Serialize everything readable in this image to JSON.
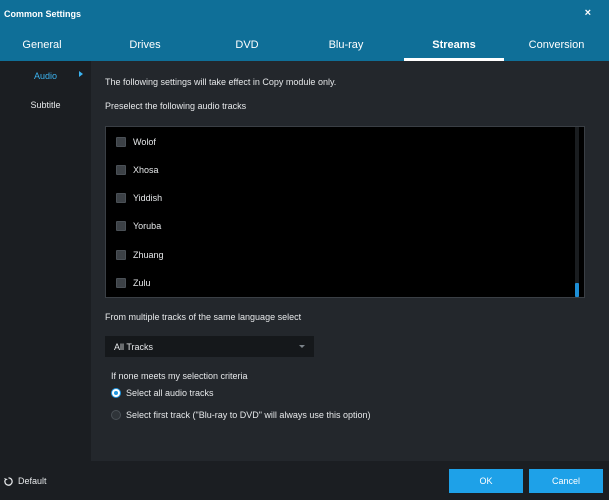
{
  "window": {
    "title": "Common Settings",
    "close_glyph": "×"
  },
  "tabs": [
    {
      "label": "General"
    },
    {
      "label": "Drives"
    },
    {
      "label": "DVD"
    },
    {
      "label": "Blu-ray"
    },
    {
      "label": "Streams",
      "active": true
    },
    {
      "label": "Conversion"
    }
  ],
  "sidebar": {
    "items": [
      {
        "label": "Audio",
        "active": true
      },
      {
        "label": "Subtitle"
      }
    ]
  },
  "main": {
    "note": "The following settings will take effect in Copy module only.",
    "preselect_label": "Preselect the following audio tracks",
    "tracks": [
      {
        "label": "Wolof",
        "checked": false
      },
      {
        "label": "Xhosa",
        "checked": false
      },
      {
        "label": "Yiddish",
        "checked": false
      },
      {
        "label": "Yoruba",
        "checked": false
      },
      {
        "label": "Zhuang",
        "checked": false
      },
      {
        "label": "Zulu",
        "checked": false
      }
    ],
    "multi_track_label": "From multiple tracks of the same language select",
    "multi_track_value": "All Tracks",
    "none_meets_label": "If none meets my selection criteria",
    "options": [
      {
        "label": "Select all audio tracks",
        "selected": true
      },
      {
        "label": "Select first track (\"Blu-ray to DVD\" will always use this option)",
        "selected": false
      }
    ]
  },
  "footer": {
    "default_label": "Default",
    "ok_label": "OK",
    "cancel_label": "Cancel"
  },
  "colors": {
    "accent": "#1ea1e8",
    "titlebar": "#0f6f98",
    "background": "#23272c",
    "sidebar": "#1b1e22"
  },
  "icons": {
    "close": "close-icon",
    "default": "reset-icon",
    "sidebar_arrow": "chevron-right-icon",
    "dropdown": "chevron-down-icon"
  }
}
